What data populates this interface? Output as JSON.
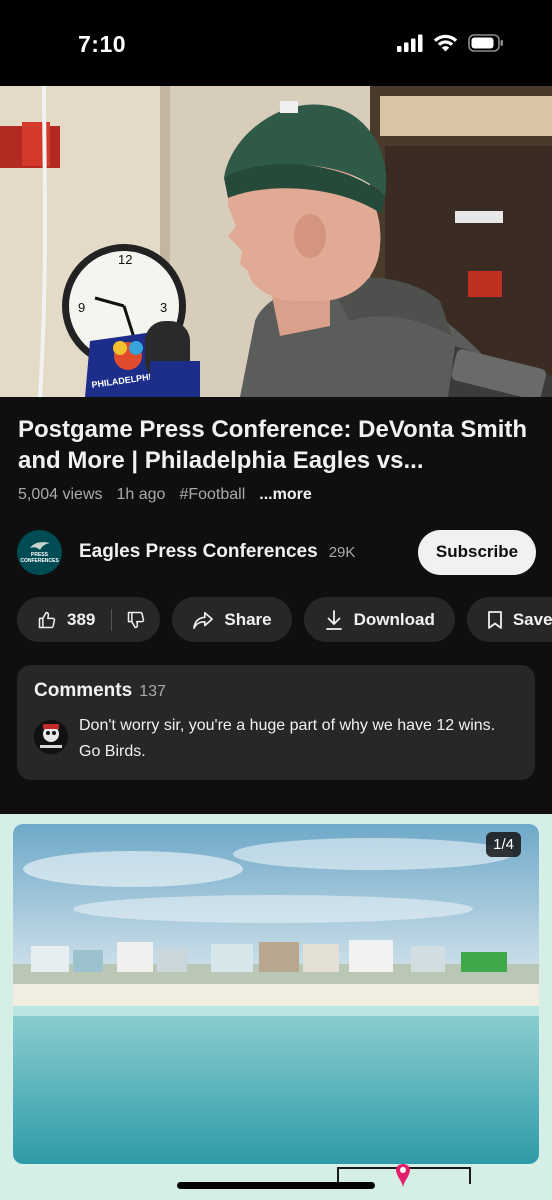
{
  "status": {
    "time": "7:10"
  },
  "video": {
    "title": "Postgame Press Conference: DeVonta Smith and More | Philadelphia Eagles vs...",
    "views": "5,004 views",
    "age": "1h ago",
    "hashtag": "#Football",
    "more_label": "...more",
    "mic_flag_text": "PHILADELPHIA"
  },
  "channel": {
    "name": "Eagles Press Conferences",
    "subscribers": "29K",
    "subscribe_label": "Subscribe",
    "avatar_text": [
      "PRESS",
      "CONFERENCES"
    ]
  },
  "actions": {
    "likes": "389",
    "share_label": "Share",
    "download_label": "Download",
    "save_label": "Save"
  },
  "comments": {
    "title": "Comments",
    "count": "137",
    "top_comment": "Don't worry sir, you're a huge part of why we have 12 wins. Go Birds."
  },
  "ad": {
    "counter": "1/4"
  }
}
